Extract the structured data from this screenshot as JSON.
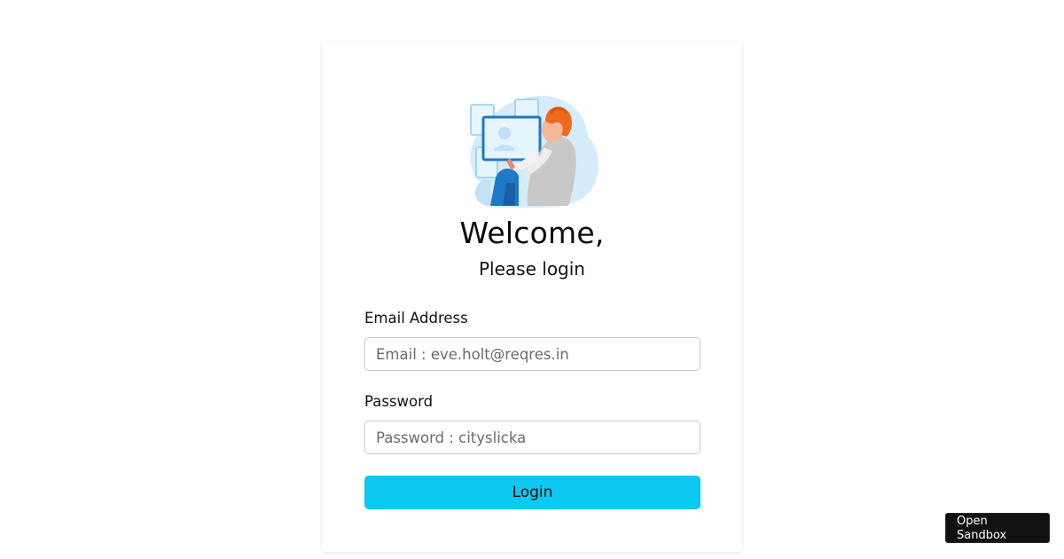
{
  "login": {
    "welcome": "Welcome,",
    "subtitle": "Please login",
    "email_label": "Email Address",
    "email_placeholder": "Email : eve.holt@reqres.in",
    "email_value": "",
    "password_label": "Password",
    "password_placeholder": "Password : cityslicka",
    "password_value": "",
    "submit_label": "Login"
  },
  "illustration": {
    "icon": "person-using-screens-illustration"
  },
  "sandbox": {
    "label": "Open Sandbox"
  },
  "colors": {
    "accent": "#0dc8f0",
    "illustration_blob": "#d6ecfb",
    "illustration_blue": "#1e78c8",
    "illustration_hair": "#f06a1e"
  }
}
